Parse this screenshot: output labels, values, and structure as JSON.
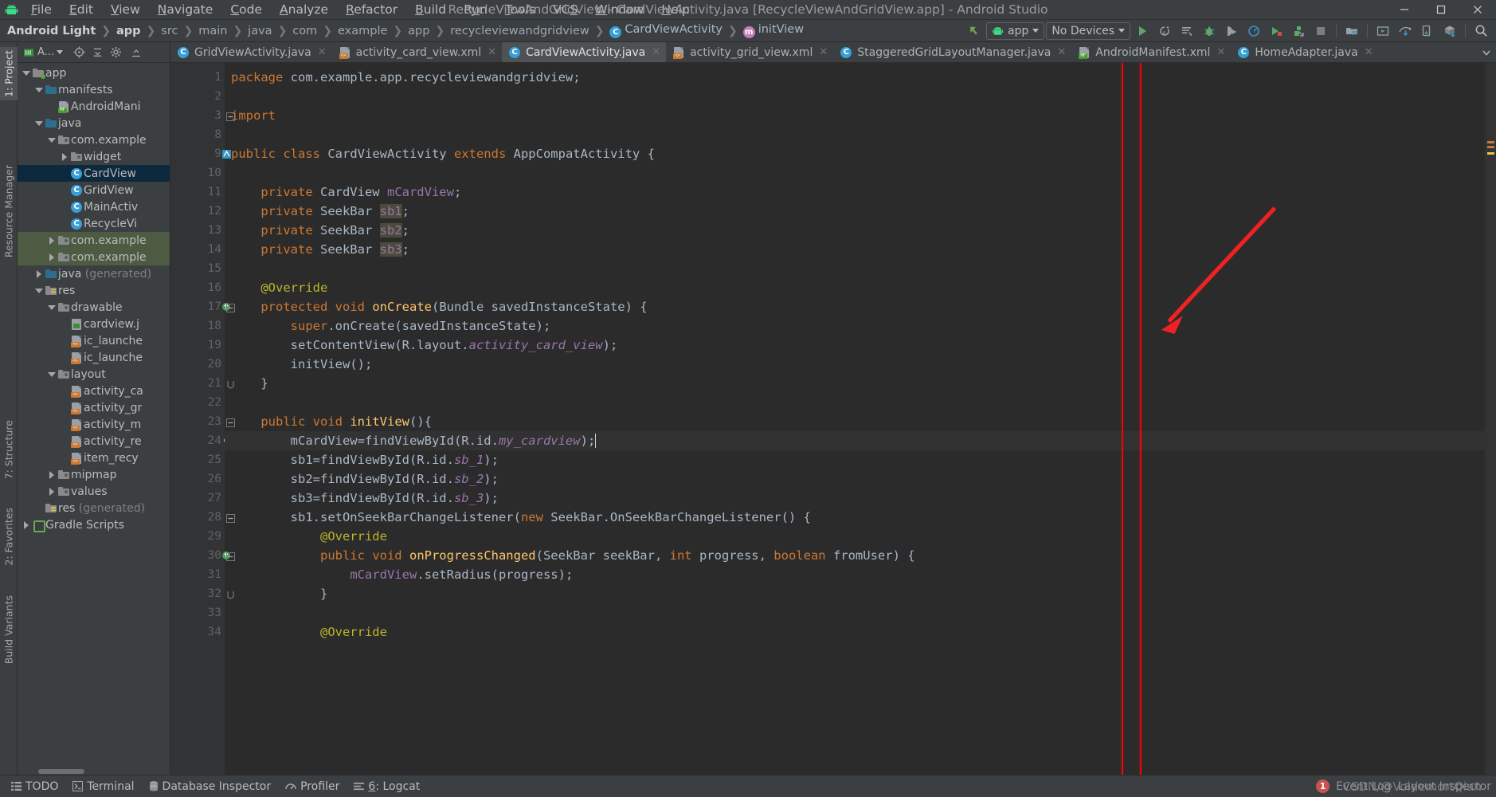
{
  "window": {
    "title": "RecycleViewAndGridView - CardViewActivity.java [RecycleViewAndGridView.app] - Android Studio",
    "app_icon": "android-robot-icon",
    "minimize_label": "─",
    "maximize_label": "□",
    "close_label": "✕"
  },
  "menubar": {
    "items": [
      {
        "label": "File",
        "mnemonic": "F"
      },
      {
        "label": "Edit",
        "mnemonic": "E"
      },
      {
        "label": "View",
        "mnemonic": "V"
      },
      {
        "label": "Navigate",
        "mnemonic": "N"
      },
      {
        "label": "Code",
        "mnemonic": "C"
      },
      {
        "label": "Analyze",
        "mnemonic": "A"
      },
      {
        "label": "Refactor",
        "mnemonic": "R"
      },
      {
        "label": "Build",
        "mnemonic": "B"
      },
      {
        "label": "Run",
        "mnemonic": "u"
      },
      {
        "label": "Tools",
        "mnemonic": "T"
      },
      {
        "label": "VCS",
        "mnemonic": "S"
      },
      {
        "label": "Window",
        "mnemonic": "W"
      },
      {
        "label": "Help",
        "mnemonic": "H"
      }
    ]
  },
  "breadcrumbs": [
    {
      "label": "Android Light",
      "style": "bold"
    },
    {
      "label": "app",
      "style": "bold"
    },
    {
      "label": "src",
      "style": "dim"
    },
    {
      "label": "main",
      "style": "dim"
    },
    {
      "label": "java",
      "style": "dim"
    },
    {
      "label": "com",
      "style": "dim"
    },
    {
      "label": "example",
      "style": "dim"
    },
    {
      "label": "app",
      "style": "dim"
    },
    {
      "label": "recycleviewandgridview",
      "style": "dim"
    },
    {
      "label": "CardViewActivity",
      "style": "class",
      "icon": "class-icon"
    },
    {
      "label": "initView",
      "style": "method",
      "icon": "method-icon"
    }
  ],
  "toolbar": {
    "back_icon": "back-arrow-icon",
    "module_selector": {
      "label": "app",
      "icon": "android-robot-icon"
    },
    "device_selector": {
      "label": "No Devices"
    },
    "actions": [
      {
        "name": "run-button",
        "icon": "green-play-icon"
      },
      {
        "name": "apply-changes-button",
        "icon": "apply-code-changes-icon"
      },
      {
        "name": "apply-code-changes-button",
        "icon": "apply-changes-icon"
      },
      {
        "name": "debug-button",
        "icon": "green-bug-icon"
      },
      {
        "name": "attach-debugger-button",
        "icon": "attach-debugger-icon"
      },
      {
        "name": "profile-button",
        "icon": "profiler-icon"
      },
      {
        "name": "run-with-coverage-button",
        "icon": "coverage-icon"
      },
      {
        "name": "stop-button",
        "icon": "stop-square-icon"
      },
      {
        "name": "sdk-manager-button",
        "icon": "sdk-manager-icon"
      },
      {
        "name": "avd-manager-button",
        "icon": "avd-manager-icon"
      },
      {
        "name": "device-file-explorer-button",
        "icon": "device-explorer-icon"
      },
      {
        "name": "layout-inspector-button",
        "icon": "layout-inspector-icon"
      },
      {
        "name": "sync-gradle-button",
        "icon": "gradle-sync-icon"
      },
      {
        "name": "search-everywhere-button",
        "icon": "search-icon"
      }
    ]
  },
  "left_tool_strip": [
    {
      "label": "1: Project",
      "active": true,
      "name": "tool-window-project"
    },
    {
      "label": "Resource Manager",
      "active": false,
      "name": "tool-window-resource-manager"
    },
    {
      "label": "7: Structure",
      "active": false,
      "name": "tool-window-structure"
    },
    {
      "label": "2: Favorites",
      "active": false,
      "name": "tool-window-favorites"
    },
    {
      "label": "Build Variants",
      "active": false,
      "name": "tool-window-build-variants"
    }
  ],
  "project_panel": {
    "toolbar_icons": [
      {
        "name": "android-view-selector",
        "label": "A..."
      },
      {
        "name": "locate-icon"
      },
      {
        "name": "collapse-all-icon"
      },
      {
        "name": "settings-gear-icon"
      },
      {
        "name": "hide-icon"
      }
    ],
    "tree": [
      {
        "depth": 0,
        "arrow": "down",
        "icon": "folder-module",
        "label": "app",
        "state": "normal"
      },
      {
        "depth": 1,
        "arrow": "down",
        "icon": "folder-blue",
        "label": "manifests",
        "state": "normal"
      },
      {
        "depth": 2,
        "arrow": "none",
        "icon": "file-manifest",
        "label": "AndroidMani",
        "state": "normal"
      },
      {
        "depth": 1,
        "arrow": "down",
        "icon": "folder-blue",
        "label": "java",
        "state": "normal"
      },
      {
        "depth": 2,
        "arrow": "down",
        "icon": "folder-package",
        "label": "com.example",
        "state": "normal"
      },
      {
        "depth": 3,
        "arrow": "right",
        "icon": "folder-package",
        "label": "widget",
        "state": "normal"
      },
      {
        "depth": 3,
        "arrow": "none",
        "icon": "class-icon",
        "label": "CardView",
        "state": "selected"
      },
      {
        "depth": 3,
        "arrow": "none",
        "icon": "class-icon",
        "label": "GridView",
        "state": "normal"
      },
      {
        "depth": 3,
        "arrow": "none",
        "icon": "class-icon",
        "label": "MainActiv",
        "state": "normal"
      },
      {
        "depth": 3,
        "arrow": "none",
        "icon": "class-icon",
        "label": "RecycleVi",
        "state": "normal"
      },
      {
        "depth": 2,
        "arrow": "right",
        "icon": "folder-package",
        "label": "com.example",
        "state": "green"
      },
      {
        "depth": 2,
        "arrow": "right",
        "icon": "folder-package",
        "label": "com.example",
        "state": "green"
      },
      {
        "depth": 1,
        "arrow": "right",
        "icon": "folder-generated",
        "label": "java",
        "suffix": " (generated)",
        "state": "normal"
      },
      {
        "depth": 1,
        "arrow": "down",
        "icon": "folder-res",
        "label": "res",
        "state": "normal"
      },
      {
        "depth": 2,
        "arrow": "down",
        "icon": "folder-package",
        "label": "drawable",
        "state": "normal"
      },
      {
        "depth": 3,
        "arrow": "none",
        "icon": "file-image",
        "label": "cardview.j",
        "state": "normal"
      },
      {
        "depth": 3,
        "arrow": "none",
        "icon": "file-xml",
        "label": "ic_launche",
        "state": "normal"
      },
      {
        "depth": 3,
        "arrow": "none",
        "icon": "file-xml",
        "label": "ic_launche",
        "state": "normal"
      },
      {
        "depth": 2,
        "arrow": "down",
        "icon": "folder-package",
        "label": "layout",
        "state": "normal"
      },
      {
        "depth": 3,
        "arrow": "none",
        "icon": "file-xml",
        "label": "activity_ca",
        "state": "normal"
      },
      {
        "depth": 3,
        "arrow": "none",
        "icon": "file-xml",
        "label": "activity_gr",
        "state": "normal"
      },
      {
        "depth": 3,
        "arrow": "none",
        "icon": "file-xml",
        "label": "activity_m",
        "state": "normal"
      },
      {
        "depth": 3,
        "arrow": "none",
        "icon": "file-xml",
        "label": "activity_re",
        "state": "normal"
      },
      {
        "depth": 3,
        "arrow": "none",
        "icon": "file-xml",
        "label": "item_recy",
        "state": "normal"
      },
      {
        "depth": 2,
        "arrow": "right",
        "icon": "folder-package",
        "label": "mipmap",
        "state": "normal"
      },
      {
        "depth": 2,
        "arrow": "right",
        "icon": "folder-package",
        "label": "values",
        "state": "normal"
      },
      {
        "depth": 1,
        "arrow": "none",
        "icon": "folder-res",
        "label": "res",
        "suffix": " (generated)",
        "state": "normal"
      },
      {
        "depth": 0,
        "arrow": "right",
        "icon": "gradle-icon",
        "label": "Gradle Scripts",
        "state": "normal"
      }
    ]
  },
  "editor_tabs": [
    {
      "label": "GridViewActivity.java",
      "icon": "class-icon",
      "active": false
    },
    {
      "label": "activity_card_view.xml",
      "icon": "xml-file-icon",
      "active": false
    },
    {
      "label": "CardViewActivity.java",
      "icon": "class-icon",
      "active": true
    },
    {
      "label": "activity_grid_view.xml",
      "icon": "xml-file-icon",
      "active": false
    },
    {
      "label": "StaggeredGridLayoutManager.java",
      "icon": "class-icon",
      "active": false
    },
    {
      "label": "AndroidManifest.xml",
      "icon": "manifest-file-icon",
      "active": false
    },
    {
      "label": "HomeAdapter.java",
      "icon": "class-icon",
      "active": false
    }
  ],
  "code": {
    "first_line": 1,
    "current_line": 24,
    "caret_col": 40,
    "lines": [
      {
        "n": 1,
        "tokens": [
          {
            "t": "package ",
            "c": "kw"
          },
          {
            "t": "com.example.app.recycleviewandgridview;",
            "c": "pkg"
          }
        ]
      },
      {
        "n": 2,
        "tokens": []
      },
      {
        "n": 3,
        "tokens": [
          {
            "t": "import ",
            "c": "kw"
          },
          {
            "t": "...",
            "c": "fold"
          }
        ],
        "fold": "minus"
      },
      {
        "n": 8,
        "tokens": []
      },
      {
        "n": 9,
        "tokens": [
          {
            "t": "public ",
            "c": "kw"
          },
          {
            "t": "class ",
            "c": "kw"
          },
          {
            "t": "CardViewActivity ",
            "c": "cls2"
          },
          {
            "t": "extends ",
            "c": "kw"
          },
          {
            "t": "AppCompatActivity ",
            "c": "cls2"
          },
          {
            "t": "{",
            "c": "plain"
          }
        ],
        "gutter": "bookmark"
      },
      {
        "n": 10,
        "tokens": []
      },
      {
        "n": 11,
        "tokens": [
          {
            "t": "    ",
            "c": "plain"
          },
          {
            "t": "private ",
            "c": "kw"
          },
          {
            "t": "CardView ",
            "c": "cls2"
          },
          {
            "t": "mCardView",
            "c": "fld"
          },
          {
            "t": ";",
            "c": "plain"
          }
        ]
      },
      {
        "n": 12,
        "tokens": [
          {
            "t": "    ",
            "c": "plain"
          },
          {
            "t": "private ",
            "c": "kw"
          },
          {
            "t": "SeekBar ",
            "c": "cls2"
          },
          {
            "t": "sb1",
            "c": "fldbg"
          },
          {
            "t": ";",
            "c": "plain"
          }
        ]
      },
      {
        "n": 13,
        "tokens": [
          {
            "t": "    ",
            "c": "plain"
          },
          {
            "t": "private ",
            "c": "kw"
          },
          {
            "t": "SeekBar ",
            "c": "cls2"
          },
          {
            "t": "sb2",
            "c": "fldbg"
          },
          {
            "t": ";",
            "c": "plain"
          }
        ]
      },
      {
        "n": 14,
        "tokens": [
          {
            "t": "    ",
            "c": "plain"
          },
          {
            "t": "private ",
            "c": "kw"
          },
          {
            "t": "SeekBar ",
            "c": "cls2"
          },
          {
            "t": "sb3",
            "c": "fldbg"
          },
          {
            "t": ";",
            "c": "plain"
          }
        ]
      },
      {
        "n": 15,
        "tokens": []
      },
      {
        "n": 16,
        "tokens": [
          {
            "t": "    ",
            "c": "plain"
          },
          {
            "t": "@Override",
            "c": "ann"
          }
        ]
      },
      {
        "n": 17,
        "tokens": [
          {
            "t": "    ",
            "c": "plain"
          },
          {
            "t": "protected ",
            "c": "kw"
          },
          {
            "t": "void ",
            "c": "kw"
          },
          {
            "t": "onCreate",
            "c": "mth2"
          },
          {
            "t": "(",
            "c": "plain"
          },
          {
            "t": "Bundle ",
            "c": "cls2"
          },
          {
            "t": "savedInstanceState) {",
            "c": "plain"
          }
        ],
        "gutter": "override",
        "fold": "minus"
      },
      {
        "n": 18,
        "tokens": [
          {
            "t": "        ",
            "c": "plain"
          },
          {
            "t": "super",
            "c": "kw"
          },
          {
            "t": ".onCreate(savedInstanceState);",
            "c": "plain"
          }
        ]
      },
      {
        "n": 19,
        "tokens": [
          {
            "t": "        setContentView(R.layout.",
            "c": "plain"
          },
          {
            "t": "activity_card_view",
            "c": "italic-f"
          },
          {
            "t": ");",
            "c": "plain"
          }
        ]
      },
      {
        "n": 20,
        "tokens": [
          {
            "t": "        initView();",
            "c": "plain"
          }
        ]
      },
      {
        "n": 21,
        "tokens": [
          {
            "t": "    }",
            "c": "plain"
          }
        ],
        "fold": "end"
      },
      {
        "n": 22,
        "tokens": []
      },
      {
        "n": 23,
        "tokens": [
          {
            "t": "    ",
            "c": "plain"
          },
          {
            "t": "public ",
            "c": "kw"
          },
          {
            "t": "void ",
            "c": "kw"
          },
          {
            "t": "initView",
            "c": "mth2"
          },
          {
            "t": "(){",
            "c": "plain"
          }
        ],
        "fold": "minus"
      },
      {
        "n": 24,
        "tokens": [
          {
            "t": "        mCardView=findViewById(R.id.",
            "c": "plain"
          },
          {
            "t": "my_cardview",
            "c": "italic-f"
          },
          {
            "t": ");",
            "c": "plain"
          }
        ],
        "gutter": "bulb",
        "current": true
      },
      {
        "n": 25,
        "tokens": [
          {
            "t": "        sb1=findViewById(R.id.",
            "c": "plain"
          },
          {
            "t": "sb_1",
            "c": "italic-f"
          },
          {
            "t": ");",
            "c": "plain"
          }
        ]
      },
      {
        "n": 26,
        "tokens": [
          {
            "t": "        sb2=findViewById(R.id.",
            "c": "plain"
          },
          {
            "t": "sb_2",
            "c": "italic-f"
          },
          {
            "t": ");",
            "c": "plain"
          }
        ]
      },
      {
        "n": 27,
        "tokens": [
          {
            "t": "        sb3=findViewById(R.id.",
            "c": "plain"
          },
          {
            "t": "sb_3",
            "c": "italic-f"
          },
          {
            "t": ");",
            "c": "plain"
          }
        ]
      },
      {
        "n": 28,
        "tokens": [
          {
            "t": "        sb1.setOnSeekBarChangeListener(",
            "c": "plain"
          },
          {
            "t": "new ",
            "c": "kw"
          },
          {
            "t": "SeekBar.OnSeekBarChangeListener() {",
            "c": "plain"
          }
        ],
        "fold": "minus"
      },
      {
        "n": 29,
        "tokens": [
          {
            "t": "            ",
            "c": "plain"
          },
          {
            "t": "@Override",
            "c": "ann"
          }
        ]
      },
      {
        "n": 30,
        "tokens": [
          {
            "t": "            ",
            "c": "plain"
          },
          {
            "t": "public ",
            "c": "kw"
          },
          {
            "t": "void ",
            "c": "kw"
          },
          {
            "t": "onProgressChanged",
            "c": "mth2"
          },
          {
            "t": "(",
            "c": "plain"
          },
          {
            "t": "SeekBar ",
            "c": "cls2"
          },
          {
            "t": "seekBar, ",
            "c": "plain"
          },
          {
            "t": "int ",
            "c": "kw"
          },
          {
            "t": "progress, ",
            "c": "plain"
          },
          {
            "t": "boolean ",
            "c": "kw"
          },
          {
            "t": "fromUser) {",
            "c": "plain"
          }
        ],
        "gutter": "override",
        "fold": "minus"
      },
      {
        "n": 31,
        "tokens": [
          {
            "t": "                ",
            "c": "plain"
          },
          {
            "t": "mCardView",
            "c": "fld"
          },
          {
            "t": ".setRadius(progress);",
            "c": "plain"
          }
        ]
      },
      {
        "n": 32,
        "tokens": [
          {
            "t": "            }",
            "c": "plain"
          }
        ],
        "fold": "end"
      },
      {
        "n": 33,
        "tokens": []
      },
      {
        "n": 34,
        "tokens": [
          {
            "t": "            ",
            "c": "plain"
          },
          {
            "t": "@Override",
            "c": "ann"
          }
        ]
      }
    ]
  },
  "annotation": {
    "box_color": "#ff0000",
    "arrow_color": "#ee2222",
    "name": "red-annotation-overlay"
  },
  "bottombar": {
    "items": [
      {
        "label": "TODO",
        "icon": "todo-icon",
        "name": "bottom-tab-todo"
      },
      {
        "label": "Terminal",
        "icon": "terminal-icon",
        "name": "bottom-tab-terminal"
      },
      {
        "label": "Database Inspector",
        "icon": "database-icon",
        "name": "bottom-tab-database-inspector"
      },
      {
        "label": "Profiler",
        "icon": "profiler-icon",
        "name": "bottom-tab-profiler"
      },
      {
        "label": "6: Logcat",
        "mnemonic": "6",
        "icon": "logcat-icon",
        "name": "bottom-tab-logcat"
      }
    ],
    "right": {
      "event_badge": "1",
      "event_label": "Event Log",
      "layout_inspector_label": "Layout Inspector"
    }
  },
  "watermark": "CSDN/@VoldemortQian"
}
